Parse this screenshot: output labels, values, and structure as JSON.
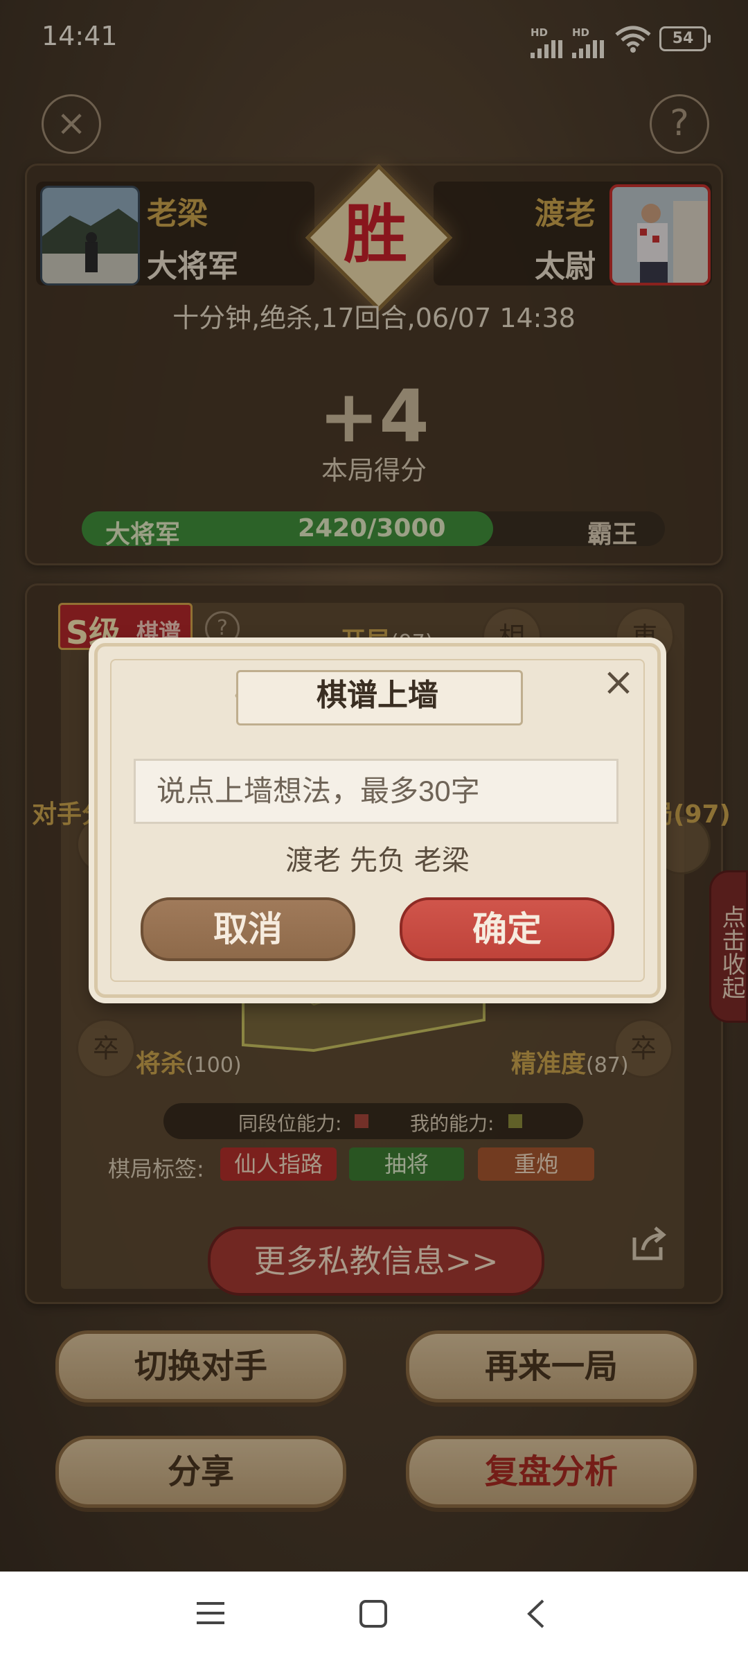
{
  "status_bar": {
    "time": "14:41",
    "signal_1": "HD",
    "signal_2": "HD",
    "battery": "54"
  },
  "header": {
    "close_icon": "close-icon",
    "help_icon": "help-icon"
  },
  "player_left": {
    "name": "老梁",
    "rank": "大将军"
  },
  "player_right": {
    "name": "渡老",
    "rank": "太尉"
  },
  "result_badge": "胜",
  "game_info": "十分钟,绝杀,17回合,06/07 14:38",
  "score": {
    "value": "+4",
    "label": "本局得分"
  },
  "progress": {
    "current_rank": "大将军",
    "text": "2420/3000",
    "next_rank": "霸王",
    "fraction": 0.8067
  },
  "rating": {
    "grade": "S级",
    "type": "棋谱",
    "help": "?"
  },
  "abilities": {
    "opening": {
      "label": "开局",
      "value": "(97)"
    },
    "midgame_value": "局(97)",
    "opponent_prefix": "对手分",
    "checkmate": {
      "label": "将杀",
      "value": "(100)"
    },
    "accuracy": {
      "label": "精准度",
      "value": "(87)"
    }
  },
  "legend": {
    "peer": "同段位能力:",
    "mine": "我的能力:",
    "peer_color": "#a4453a",
    "mine_color": "#8a8a3a"
  },
  "tags": {
    "label": "棋局标签:",
    "items": [
      "仙人指路",
      "抽将",
      "重炮"
    ]
  },
  "more_button": "更多私教信息>>",
  "side_tab": "点击收起",
  "actions": {
    "switch": "切换对手",
    "again": "再来一局",
    "share": "分享",
    "review": "复盘分析"
  },
  "modal": {
    "title": "棋谱上墙",
    "input_placeholder": "说点上墙想法，最多30字",
    "result": "渡老 先负 老梁",
    "cancel": "取消",
    "confirm": "确定"
  },
  "colors": {
    "gold": "#c9a24d",
    "green": "#3f8d3a",
    "red": "#c4473f",
    "brown": "#8e6a4a"
  }
}
